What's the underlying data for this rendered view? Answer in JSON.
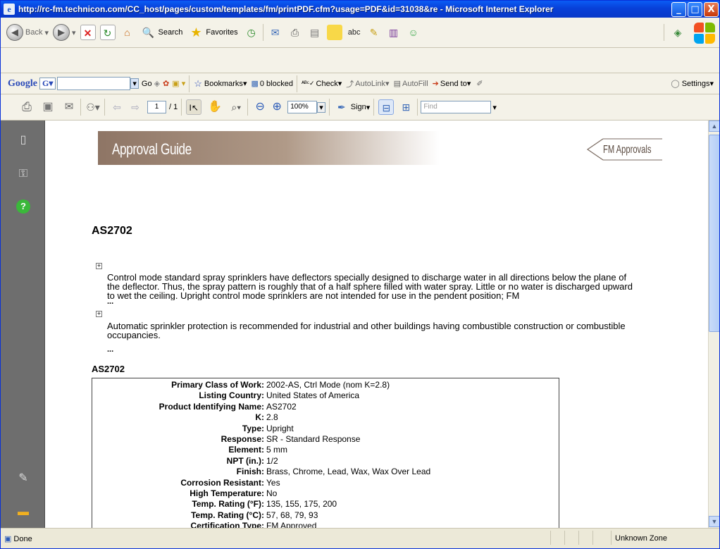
{
  "window": {
    "title": "http://rc-fm.technicon.com/CC_host/pages/custom/templates/fm/printPDF.cfm?usage=PDF&id=31038&re - Microsoft Internet Explorer",
    "minimize": "_",
    "maximize": "□",
    "close": "X"
  },
  "ie_toolbar": {
    "back": "Back",
    "search": "Search",
    "favorites": "Favorites"
  },
  "google_toolbar": {
    "brand": "Google",
    "search_value": "",
    "go": "Go",
    "bookmarks": "Bookmarks",
    "blocked": "0 blocked",
    "check": "Check",
    "autolink": "AutoLink",
    "autofill": "AutoFill",
    "send_to": "Send to",
    "settings": "Settings"
  },
  "adobe_toolbar": {
    "current_page": "1",
    "page_total": "/ 1",
    "zoom": "100%",
    "sign": "Sign",
    "find_placeholder": "Find"
  },
  "document": {
    "banner_title": "Approval Guide",
    "logo_text": "FM Approvals",
    "heading": "AS2702",
    "paragraph1": "Control mode standard spray sprinklers have deflectors specially designed to discharge water in all directions below the plane of the deflector. Thus, the spray pattern is roughly that of a half sphere filled with water spray. Little or no water is discharged upward to wet the ceiling. Upright control mode sprinklers are not intended for use in the pendent position; FM",
    "paragraph2": "Automatic sprinkler protection is recommended for industrial and other buildings having combustible construction or combustible occupancies.",
    "ellipsis": "...",
    "sub_heading": "AS2702",
    "details": [
      {
        "label": "Primary Class of Work:",
        "value": "2002-AS, Ctrl Mode (nom K=2.8)"
      },
      {
        "label": "Listing Country:",
        "value": "United States of America"
      },
      {
        "label": "Product Identifying Name:",
        "value": "AS2702"
      },
      {
        "label": "K:",
        "value": "2.8"
      },
      {
        "label": "Type:",
        "value": "Upright"
      },
      {
        "label": "Response:",
        "value": "SR - Standard Response"
      },
      {
        "label": "Element:",
        "value": "5 mm"
      },
      {
        "label": "NPT (in.):",
        "value": "1/2"
      },
      {
        "label": "Finish:",
        "value": "Brass, Chrome, Lead, Wax, Wax Over Lead"
      },
      {
        "label": "Corrosion Resistant:",
        "value": "Yes"
      },
      {
        "label": "High Temperature:",
        "value": "No"
      },
      {
        "label": "Temp. Rating (°F):",
        "value": "135, 155, 175, 200"
      },
      {
        "label": "Temp. Rating (°C):",
        "value": "57, 68, 79, 93"
      },
      {
        "label": "Certification Type:",
        "value": "FM Approved"
      }
    ]
  },
  "status": {
    "left": "Done",
    "zone": "Unknown Zone"
  }
}
